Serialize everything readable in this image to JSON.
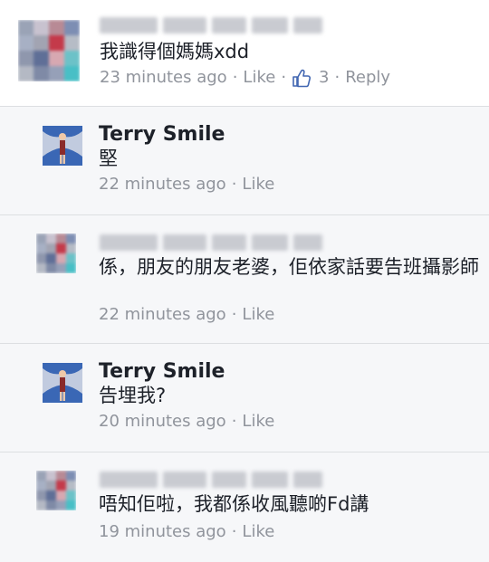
{
  "comments": [
    {
      "kind": "top",
      "author": "",
      "text": "我識得個媽媽xdd",
      "time": "23 minutes ago",
      "like_label": "Like",
      "like_count": "3",
      "reply_label": "Reply"
    },
    {
      "kind": "reply",
      "author": "Terry Smile",
      "text": "堅",
      "time": "22 minutes ago",
      "like_label": "Like"
    },
    {
      "kind": "reply",
      "author": "",
      "text": "係，朋友的朋友老婆，佢依家話要告班攝影師",
      "time": "22 minutes ago",
      "like_label": "Like"
    },
    {
      "kind": "reply",
      "author": "Terry Smile",
      "text": "告埋我?",
      "time": "20 minutes ago",
      "like_label": "Like"
    },
    {
      "kind": "reply",
      "author": "",
      "text": "唔知佢啦，我都係收風聽啲Fd講",
      "time": "19 minutes ago",
      "like_label": "Like"
    }
  ],
  "icons": {
    "like_thumb": "thumbs-up-icon",
    "separator": "·"
  },
  "colors": {
    "link_blue": "#4267b2",
    "meta_gray": "#90949c",
    "text": "#1d2129",
    "divider": "#dddfe2"
  }
}
